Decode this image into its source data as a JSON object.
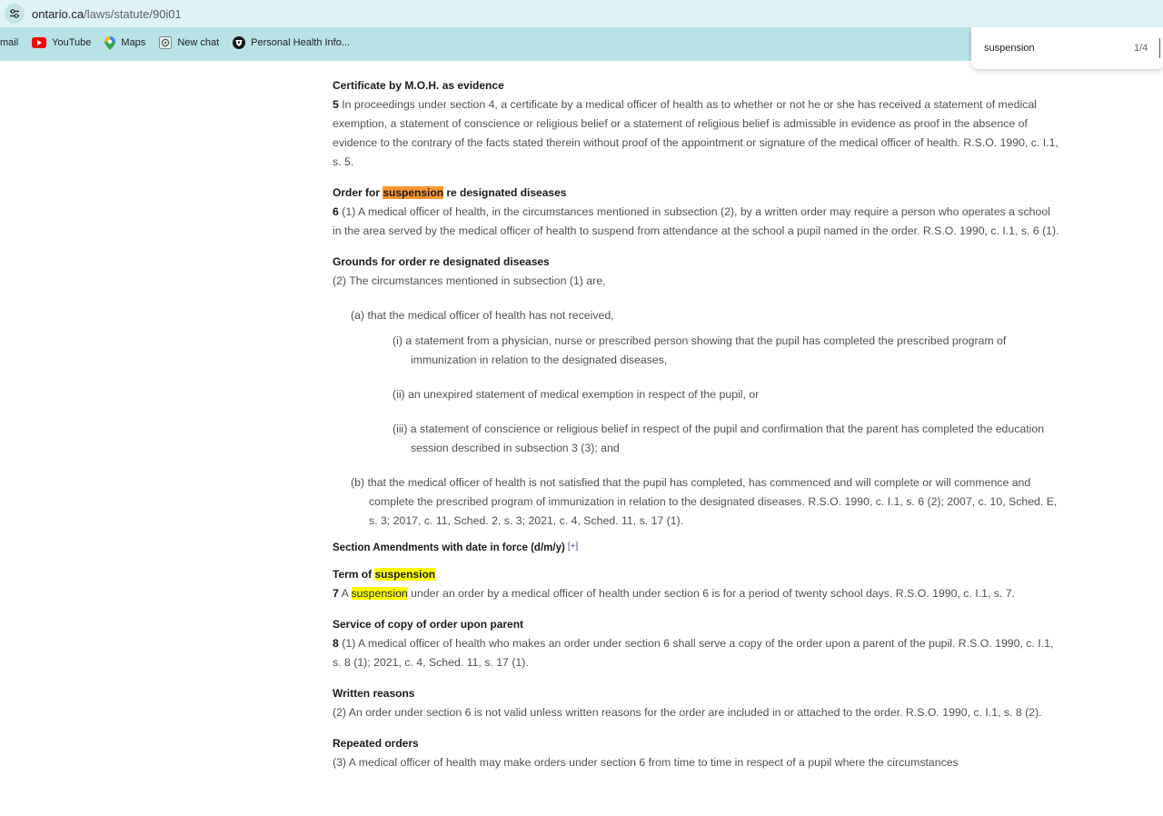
{
  "browser": {
    "url_host": "ontario.ca",
    "url_path": "/laws/statute/90i01",
    "bookmarks": [
      {
        "label": "mail",
        "icon": "gmail-icon"
      },
      {
        "label": "YouTube",
        "icon": "youtube-icon"
      },
      {
        "label": "Maps",
        "icon": "maps-pin-icon"
      },
      {
        "label": "New chat",
        "icon": "chatgpt-icon"
      },
      {
        "label": "Personal Health Info...",
        "icon": "brave-icon"
      }
    ],
    "find": {
      "query": "suspension",
      "count": "1/4"
    }
  },
  "doc": {
    "s5": {
      "heading": "Certificate by M.O.H. as evidence",
      "num": "5",
      "text": " In proceedings under section 4, a certificate by a medical officer of health as to whether or not he or she has received a statement of medical exemption, a statement of conscience or religious belief or a statement of religious belief is admissible in evidence as proof in the absence of evidence to the contrary of the facts stated therein without proof of the appointment or signature of the medical officer of health.  R.S.O. 1990, c. I.1, s. 5."
    },
    "s6": {
      "heading_pre": "Order for ",
      "heading_hl": "suspension",
      "heading_post": " re designated diseases",
      "num": "6",
      "text": " (1) A medical officer of health, in the circumstances mentioned in subsection (2), by a written order may require a person who operates a school in the area served by the medical officer of health to suspend from attendance at the school a pupil named in the order.  R.S.O. 1990, c. I.1, s. 6 (1)."
    },
    "s6_2": {
      "heading": "Grounds for order re designated diseases",
      "text": "(2) The circumstances mentioned in subsection (1) are,",
      "a": "(a)  that the medical officer of health has not received,",
      "i": "(i)  a statement from a physician, nurse or prescribed person showing that the pupil has completed the prescribed program of immunization in relation to the designated diseases,",
      "ii": "(ii)  an unexpired statement of medical exemption in respect of the pupil, or",
      "iii": "(iii)  a statement of conscience or religious belief in respect of the pupil and confirmation that the parent has completed the education session described in subsection 3 (3); and",
      "b": "(b)  that the medical officer of health is not satisfied that the pupil has completed, has commenced and will complete or will commence and complete the prescribed program of immunization in relation to the designated diseases.  R.S.O. 1990, c. I.1, s. 6 (2); 2007, c. 10, Sched. E, s. 3; 2017, c. 11, Sched. 2, s. 3; 2021, c. 4, Sched. 11, s. 17 (1)."
    },
    "amend": {
      "label": "Section Amendments with date in force (d/m/y)",
      "toggle": "[+]"
    },
    "s7": {
      "heading_pre": "Term of ",
      "heading_hl": "suspension",
      "num": "7",
      "text_pre": " A ",
      "text_hl": "suspension",
      "text_post": " under an order by a medical officer of health under section 6 is for a period of twenty school days.  R.S.O. 1990, c. I.1, s. 7."
    },
    "s8": {
      "heading": "Service of copy of order upon parent",
      "num": "8",
      "text": " (1) A medical officer of health who makes an order under section 6 shall serve a copy of the order upon a parent of the pupil.  R.S.O. 1990, c. I.1, s. 8 (1); 2021, c. 4, Sched. 11, s. 17 (1)."
    },
    "s8_2": {
      "heading": "Written reasons",
      "text": "(2) An order under section 6 is not valid unless written reasons for the order are included in or attached to the order.  R.S.O. 1990, c. I.1, s. 8 (2)."
    },
    "s8_3": {
      "heading": "Repeated orders",
      "text": "(3) A medical officer of health may make orders under section 6 from time to time in respect of a pupil where the circumstances"
    }
  }
}
